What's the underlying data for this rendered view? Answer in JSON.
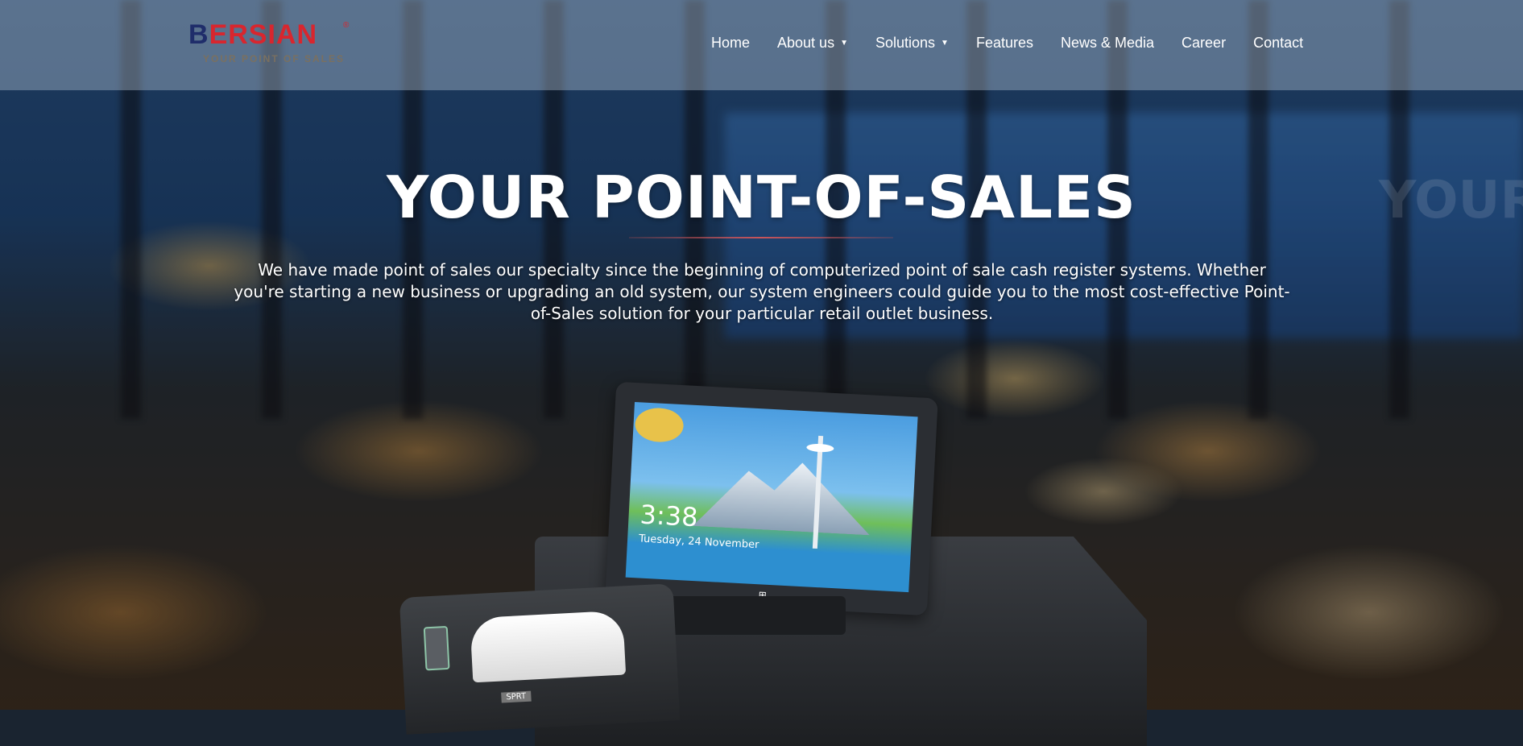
{
  "header": {
    "logo": {
      "text_a": "B",
      "text_b": "ERSIAN",
      "registered": "®",
      "tagline": "YOUR POINT OF SALES"
    },
    "nav": [
      {
        "label": "Home",
        "has_dropdown": false
      },
      {
        "label": "About us",
        "has_dropdown": true
      },
      {
        "label": "Solutions",
        "has_dropdown": true
      },
      {
        "label": "Features",
        "has_dropdown": false
      },
      {
        "label": "News & Media",
        "has_dropdown": false
      },
      {
        "label": "Career",
        "has_dropdown": false
      },
      {
        "label": "Contact",
        "has_dropdown": false
      }
    ],
    "dropdown_glyph": "▼"
  },
  "hero": {
    "title": "YOUR POINT-OF-SALES",
    "ghost_title": "YOUR",
    "description": "We have made point of sales our specialty since the beginning of computerized point of sale cash register systems. Whether you're starting a new business or upgrading an old system, our system engineers could guide you to the most cost-effective Point-of-Sales solution for your particular retail outlet business.",
    "accent_color": "#c8545a"
  },
  "device": {
    "time": "3:38",
    "date": "Tuesday, 24 November",
    "windows_glyph": "⊞",
    "printer_label": "SPRT"
  },
  "colors": {
    "brand_red": "#d8262e",
    "brand_navy": "#1f2d6a",
    "nav_text": "#ffffff"
  }
}
